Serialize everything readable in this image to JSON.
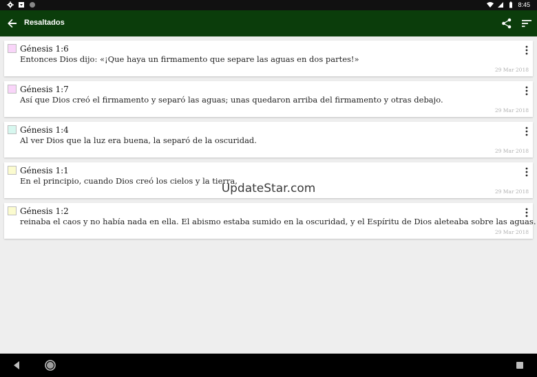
{
  "status_bar": {
    "time": "8:45",
    "left_icons": [
      "settings-icon",
      "download-icon",
      "circle-icon"
    ],
    "right_icons": [
      "wifi-icon",
      "signal-icon",
      "battery-icon"
    ]
  },
  "app_bar": {
    "title": "Resaltados",
    "background": "#0b3d0b",
    "actions": [
      "share-icon",
      "sort-icon"
    ]
  },
  "highlights": [
    {
      "ref": "Génesis 1:6",
      "text": "Entonces Dios dijo: «¡Que haya un firmamento que separe las aguas en dos partes!»",
      "date": "29 Mar 2018",
      "color": "#f9d5f9"
    },
    {
      "ref": "Génesis 1:7",
      "text": "Así que Dios creó el firmamento y separó las aguas; unas quedaron arriba del firmamento y otras debajo.",
      "date": "29 Mar 2018",
      "color": "#f9d5f9"
    },
    {
      "ref": "Génesis 1:4",
      "text": "Al ver Dios que la luz era buena, la separó de la oscuridad.",
      "date": "29 Mar 2018",
      "color": "#d7f7ef"
    },
    {
      "ref": "Génesis 1:1",
      "text": "En el principio, cuando Dios creó los cielos y la tierra,",
      "date": "29 Mar 2018",
      "color": "#fbfbcf"
    },
    {
      "ref": "Génesis 1:2",
      "text": "reinaba el caos y no había nada en ella. El abismo estaba sumido en la oscuridad, y el Espíritu de Dios aleteaba sobre las aguas.",
      "date": "29 Mar 2018",
      "color": "#fbfbcf"
    }
  ],
  "watermark": "UpdateStar.com",
  "nav_bar": {
    "icons": [
      "nav-back-icon",
      "nav-home-icon",
      "nav-recents-icon"
    ]
  }
}
